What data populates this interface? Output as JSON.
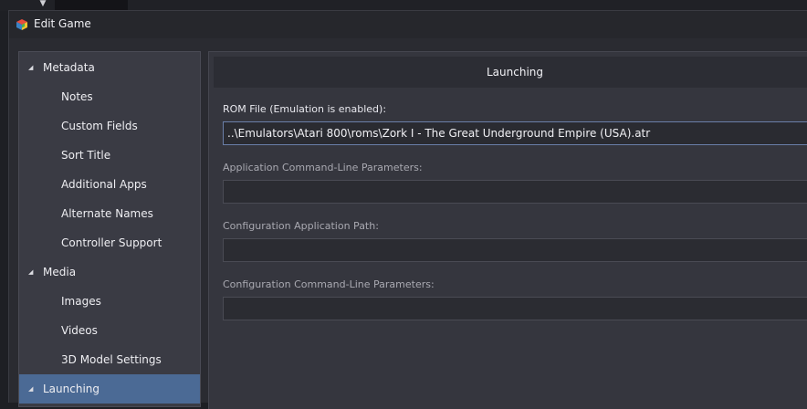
{
  "window": {
    "title": "Edit Game"
  },
  "sidebar": {
    "items": [
      {
        "label": "Metadata",
        "level": "parent",
        "expanded": true,
        "selected": false
      },
      {
        "label": "Notes",
        "level": "child",
        "selected": false
      },
      {
        "label": "Custom Fields",
        "level": "child",
        "selected": false
      },
      {
        "label": "Sort Title",
        "level": "child",
        "selected": false
      },
      {
        "label": "Additional Apps",
        "level": "child",
        "selected": false
      },
      {
        "label": "Alternate Names",
        "level": "child",
        "selected": false
      },
      {
        "label": "Controller Support",
        "level": "child",
        "selected": false
      },
      {
        "label": "Media",
        "level": "parent",
        "expanded": true,
        "selected": false
      },
      {
        "label": "Images",
        "level": "child",
        "selected": false
      },
      {
        "label": "Videos",
        "level": "child",
        "selected": false
      },
      {
        "label": "3D Model Settings",
        "level": "child",
        "selected": false
      },
      {
        "label": "Launching",
        "level": "parent",
        "expanded": true,
        "selected": true
      }
    ],
    "selected_color": "#4b6a95"
  },
  "main": {
    "section_title": "Launching",
    "fields": [
      {
        "label": "ROM File (Emulation is enabled):",
        "value": "..\\Emulators\\Atari 800\\roms\\Zork I - The Great Underground Empire (USA).atr",
        "focused": true
      },
      {
        "label": "Application Command-Line Parameters:",
        "value": ""
      },
      {
        "label": "Configuration Application Path:",
        "value": ""
      },
      {
        "label": "Configuration Command-Line Parameters:",
        "value": ""
      }
    ]
  },
  "icons": {
    "app_icon": "launchbox-cube-icon",
    "expand_icon": "triangle-expanded-icon",
    "dropdown": "chevron-down-icon"
  }
}
